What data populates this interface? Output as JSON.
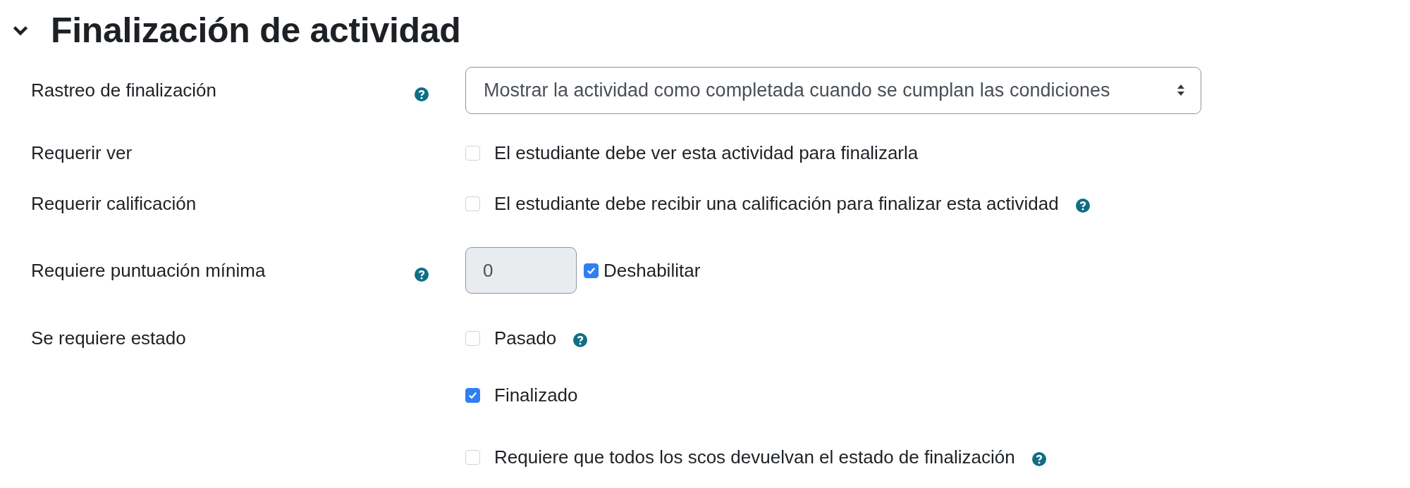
{
  "section": {
    "title": "Finalización de actividad",
    "expanded": true
  },
  "rows": [
    {
      "kind": "select",
      "label": "Rastreo de finalización",
      "help": true,
      "value": "Mostrar la actividad como completada cuando se cumplan las condiciones"
    },
    {
      "kind": "checkboxes",
      "label": "Requerir ver",
      "help": false,
      "options": [
        {
          "text": "El estudiante debe ver esta actividad para finalizarla",
          "checked": false,
          "help": false
        }
      ]
    },
    {
      "kind": "checkboxes",
      "label": "Requerir calificación",
      "help": false,
      "options": [
        {
          "text": "El estudiante debe recibir una calificación para finalizar esta actividad",
          "checked": false,
          "help": true
        }
      ]
    },
    {
      "kind": "number",
      "label": "Requiere puntuación mínima",
      "help": true,
      "value": "0",
      "toggle": {
        "text": "Deshabilitar",
        "checked": true
      }
    },
    {
      "kind": "checkboxes",
      "label": "Se requiere estado",
      "help": false,
      "options": [
        {
          "text": "Pasado",
          "checked": false,
          "help": true
        },
        {
          "text": "Finalizado",
          "checked": true,
          "help": false
        },
        {
          "text": "Requiere que todos los scos devuelvan el estado de finalización",
          "checked": false,
          "help": true
        }
      ]
    }
  ]
}
